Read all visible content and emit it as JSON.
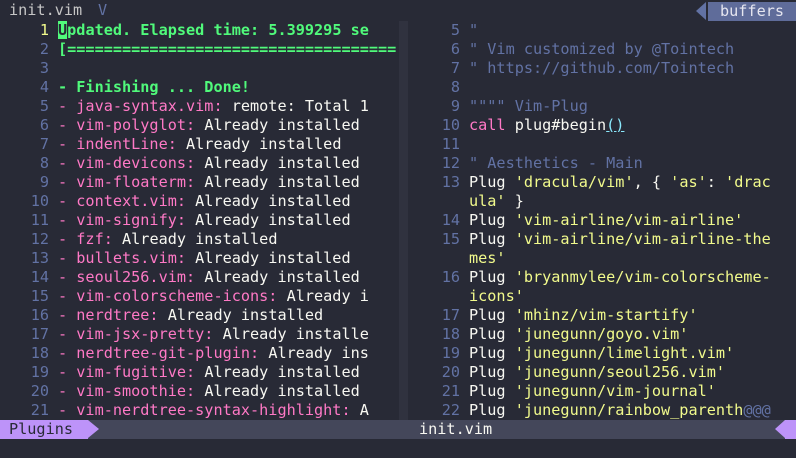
{
  "tabline": {
    "title": "init.vim",
    "v_mark": "V",
    "buffers_label": "buffers"
  },
  "left_pane": {
    "lines": [
      {
        "num": "1",
        "current": true,
        "segments": [
          {
            "s": "cursor",
            "t": "U"
          },
          {
            "s": "green",
            "t": "pdated. Elapsed time: 5.399295 se"
          }
        ]
      },
      {
        "num": "2",
        "segments": [
          {
            "s": "green",
            "t": "[===================================="
          }
        ]
      },
      {
        "num": "3",
        "segments": []
      },
      {
        "num": "4",
        "segments": [
          {
            "s": "green",
            "t": "- Finishing ... Done!"
          }
        ]
      },
      {
        "num": "5",
        "segments": [
          {
            "s": "pink",
            "t": "- java-syntax.vim: "
          },
          {
            "s": "fg",
            "t": "remote: Total 1"
          }
        ]
      },
      {
        "num": "6",
        "segments": [
          {
            "s": "pink",
            "t": "- vim-polyglot: "
          },
          {
            "s": "fg",
            "t": "Already installed"
          }
        ]
      },
      {
        "num": "7",
        "segments": [
          {
            "s": "pink",
            "t": "- indentLine: "
          },
          {
            "s": "fg",
            "t": "Already installed"
          }
        ]
      },
      {
        "num": "8",
        "segments": [
          {
            "s": "pink",
            "t": "- vim-devicons: "
          },
          {
            "s": "fg",
            "t": "Already installed"
          }
        ]
      },
      {
        "num": "9",
        "segments": [
          {
            "s": "pink",
            "t": "- vim-floaterm: "
          },
          {
            "s": "fg",
            "t": "Already installed"
          }
        ]
      },
      {
        "num": "10",
        "segments": [
          {
            "s": "pink",
            "t": "- context.vim: "
          },
          {
            "s": "fg",
            "t": "Already installed"
          }
        ]
      },
      {
        "num": "11",
        "segments": [
          {
            "s": "pink",
            "t": "- vim-signify: "
          },
          {
            "s": "fg",
            "t": "Already installed"
          }
        ]
      },
      {
        "num": "12",
        "segments": [
          {
            "s": "pink",
            "t": "- fzf: "
          },
          {
            "s": "fg",
            "t": "Already installed"
          }
        ]
      },
      {
        "num": "13",
        "segments": [
          {
            "s": "pink",
            "t": "- bullets.vim: "
          },
          {
            "s": "fg",
            "t": "Already installed"
          }
        ]
      },
      {
        "num": "14",
        "segments": [
          {
            "s": "pink",
            "t": "- seoul256.vim: "
          },
          {
            "s": "fg",
            "t": "Already installed"
          }
        ]
      },
      {
        "num": "15",
        "segments": [
          {
            "s": "pink",
            "t": "- vim-colorscheme-icons: "
          },
          {
            "s": "fg",
            "t": "Already i"
          }
        ]
      },
      {
        "num": "16",
        "segments": [
          {
            "s": "pink",
            "t": "- nerdtree: "
          },
          {
            "s": "fg",
            "t": "Already installed"
          }
        ]
      },
      {
        "num": "17",
        "segments": [
          {
            "s": "pink",
            "t": "- vim-jsx-pretty: "
          },
          {
            "s": "fg",
            "t": "Already installe"
          }
        ]
      },
      {
        "num": "18",
        "segments": [
          {
            "s": "pink",
            "t": "- nerdtree-git-plugin: "
          },
          {
            "s": "fg",
            "t": "Already ins"
          }
        ]
      },
      {
        "num": "19",
        "segments": [
          {
            "s": "pink",
            "t": "- vim-fugitive: "
          },
          {
            "s": "fg",
            "t": "Already installed"
          }
        ]
      },
      {
        "num": "20",
        "segments": [
          {
            "s": "pink",
            "t": "- vim-smoothie: "
          },
          {
            "s": "fg",
            "t": "Already installed"
          }
        ]
      },
      {
        "num": "21",
        "segments": [
          {
            "s": "pink",
            "t": "- vim-nerdtree-syntax-highlight: "
          },
          {
            "s": "fg",
            "t": "A"
          }
        ]
      }
    ]
  },
  "right_pane": {
    "lines": [
      {
        "num": "5",
        "segments": [
          {
            "s": "comment",
            "t": "\""
          }
        ]
      },
      {
        "num": "6",
        "segments": [
          {
            "s": "comment",
            "t": "\" Vim customized by @Tointech"
          }
        ]
      },
      {
        "num": "7",
        "segments": [
          {
            "s": "comment",
            "t": "\" https://github.com/Tointech"
          }
        ]
      },
      {
        "num": "8",
        "segments": []
      },
      {
        "num": "9",
        "segments": [
          {
            "s": "comment",
            "t": "\"\"\"\" Vim-Plug"
          }
        ]
      },
      {
        "num": "10",
        "segments": [
          {
            "s": "kw",
            "t": "call "
          },
          {
            "s": "fg",
            "t": "plug#begin"
          },
          {
            "s": "paren",
            "t": "()"
          }
        ]
      },
      {
        "num": "11",
        "segments": []
      },
      {
        "num": "12",
        "segments": [
          {
            "s": "comment",
            "t": "\" Aesthetics - Main"
          }
        ]
      },
      {
        "num": "13",
        "segments": [
          {
            "s": "plug",
            "t": "Plug "
          },
          {
            "s": "yellow",
            "t": "'dracula/vim'"
          },
          {
            "s": "fg",
            "t": ", { "
          },
          {
            "s": "yellow",
            "t": "'as'"
          },
          {
            "s": "fg",
            "t": ": "
          },
          {
            "s": "yellow",
            "t": "'drac"
          }
        ]
      },
      {
        "num": "",
        "segments": [
          {
            "s": "yellow",
            "t": "ula'"
          },
          {
            "s": "fg",
            "t": " }"
          }
        ]
      },
      {
        "num": "14",
        "segments": [
          {
            "s": "plug",
            "t": "Plug "
          },
          {
            "s": "yellow",
            "t": "'vim-airline/vim-airline'"
          }
        ]
      },
      {
        "num": "15",
        "segments": [
          {
            "s": "plug",
            "t": "Plug "
          },
          {
            "s": "yellow",
            "t": "'vim-airline/vim-airline-the"
          }
        ]
      },
      {
        "num": "",
        "segments": [
          {
            "s": "yellow",
            "t": "mes'"
          }
        ]
      },
      {
        "num": "16",
        "segments": [
          {
            "s": "plug",
            "t": "Plug "
          },
          {
            "s": "yellow",
            "t": "'bryanmylee/vim-colorscheme-"
          }
        ]
      },
      {
        "num": "",
        "segments": [
          {
            "s": "yellow",
            "t": "icons'"
          }
        ]
      },
      {
        "num": "17",
        "segments": [
          {
            "s": "plug",
            "t": "Plug "
          },
          {
            "s": "yellow",
            "t": "'mhinz/vim-startify'"
          }
        ]
      },
      {
        "num": "18",
        "segments": [
          {
            "s": "plug",
            "t": "Plug "
          },
          {
            "s": "yellow",
            "t": "'junegunn/goyo.vim'"
          }
        ]
      },
      {
        "num": "19",
        "segments": [
          {
            "s": "plug",
            "t": "Plug "
          },
          {
            "s": "yellow",
            "t": "'junegunn/limelight.vim'"
          }
        ]
      },
      {
        "num": "20",
        "segments": [
          {
            "s": "plug",
            "t": "Plug "
          },
          {
            "s": "yellow",
            "t": "'junegunn/seoul256.vim'"
          }
        ]
      },
      {
        "num": "21",
        "segments": [
          {
            "s": "plug",
            "t": "Plug "
          },
          {
            "s": "yellow",
            "t": "'junegunn/vim-journal'"
          }
        ]
      },
      {
        "num": "22",
        "segments": [
          {
            "s": "plug",
            "t": "Plug "
          },
          {
            "s": "yellow",
            "t": "'junegunn/rainbow_parenth"
          },
          {
            "s": "comment",
            "t": "@@@"
          }
        ]
      }
    ]
  },
  "statusline": {
    "mode_label": "Plugins",
    "filename": "init.vim"
  },
  "colors": {
    "background": "#282a36",
    "purple_accent": "#bd93f9",
    "green": "#50fa7b",
    "pink": "#ff79c6",
    "yellow": "#f1fa8c",
    "comment": "#6272a4"
  }
}
